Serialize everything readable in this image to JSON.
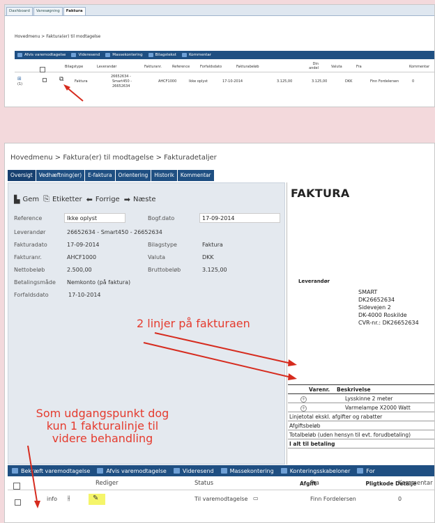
{
  "top": {
    "tabs": [
      "Dashboard",
      "Varesøgning",
      "Faktura"
    ],
    "breadcrumb": "Hovedmenu  >  Faktura(er) til modtagelse",
    "toolbar": [
      "Afvis varemodtagelse",
      "Videresend",
      "Massekontering",
      "Bilagstekst",
      "Kommentar"
    ],
    "columns": [
      "Bilagstype",
      "Leverandør",
      "Fakturanr.",
      "Reference",
      "Forfaldsdato",
      "Fakturabeløb",
      "Din andel",
      "Valuta",
      "Fra",
      "Kommentar"
    ],
    "row": {
      "expander": "⊞",
      "count": "(1)",
      "bilagstype": "Faktura",
      "leverandor": [
        "26652634 -",
        "Smart450 -",
        "26652634"
      ],
      "fakturanr": "AHCF1000",
      "reference": "Ikke oplyst",
      "forfaldsdato": "17-10-2014",
      "fakturabelob": "3.125,00",
      "din_andel": "3.125,00",
      "valuta": "DKK",
      "fra": "Finn Fordelersen",
      "kommentar": "0"
    }
  },
  "main": {
    "breadcrumb": "Hovedmenu  >  Faktura(er) til modtagelse  >  Fakturadetaljer",
    "tabs": [
      "Oversigt",
      "Vedhæftning(er)",
      "E-faktura",
      "Orientering",
      "Historik",
      "Kommentar"
    ],
    "actions": [
      "Gem",
      "Etiketter",
      "Forrige",
      "Næste"
    ],
    "fields": {
      "reference_label": "Reference",
      "reference_value": "Ikke oplyst",
      "bogf_label": "Bogf.dato",
      "bogf_value": "17-09-2014",
      "leverandor_label": "Leverandør",
      "leverandor_value": "26652634 - Smart450 - 26652634",
      "fakturadato_label": "Fakturadato",
      "fakturadato_value": "17-09-2014",
      "bilagstype_label": "Bilagstype",
      "bilagstype_value": "Faktura",
      "fakturanr_label": "Fakturanr.",
      "fakturanr_value": "AHCF1000",
      "valuta_label": "Valuta",
      "valuta_value": "DKK",
      "netto_label": "Nettobeløb",
      "netto_value": "2.500,00",
      "brutto_label": "Bruttobeløb",
      "brutto_value": "3.125,00",
      "betaling_label": "Betalingsmåde",
      "betaling_value": "Nemkonto (på faktura)",
      "forfald_label": "Forfaldsdato",
      "forfald_value": "17-10-2014"
    },
    "invoice": {
      "title": "FAKTURA",
      "lev_label": "Leverandør",
      "lev_lines": [
        "SMART",
        "DK26652634",
        "Sidevejen 2",
        "DK-4000 Roskilde",
        "CVR-nr.: DK26652634"
      ],
      "col_varenr": "Varenr.",
      "col_beskrivelse": "Beskrivelse",
      "lines": [
        "Lysskinne 2 meter",
        "Varmelampe X2000 Watt"
      ],
      "summary": [
        "Linjetotal ekskl. afgifter og rabatter",
        "Afgiftsbeløb",
        "Totalbeløb (uden hensyn til evt. forudbetaling)",
        "I alt til betaling"
      ],
      "afgift": "Afgift",
      "pligtkode": "Pligtkode Detalje"
    },
    "bottom_toolbar": [
      "Bekræft varemodtagelse",
      "Afvis varemodtagelse",
      "Videresend",
      "Massekontering",
      "Konteringsskabeloner",
      "For"
    ],
    "bottom_columns": [
      "Rediger",
      "Status",
      "Fra",
      "Kommentar"
    ],
    "bottom_row": {
      "info": "info",
      "status": "Til varemodtagelse",
      "fra": "Finn Fordelersen",
      "kommentar": "0"
    }
  },
  "annotations": {
    "two_lines": "2 linjer på fakturaen",
    "one_line": [
      "Som udgangspunkt dog",
      "kun 1 fakturalinje til",
      "videre behandling"
    ]
  }
}
